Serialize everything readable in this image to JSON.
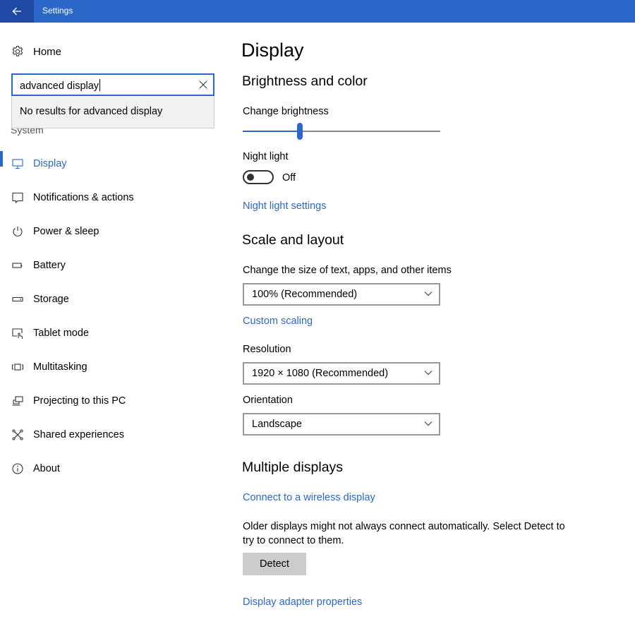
{
  "window": {
    "title": "Settings",
    "back_icon": "arrow-left-icon",
    "accent_color": "#2b67c8",
    "back_button_color": "#1f49a4"
  },
  "sidebar": {
    "home": {
      "label": "Home",
      "icon": "gear-icon"
    },
    "search": {
      "value": "advanced display",
      "clear_icon": "close-icon"
    },
    "search_results": {
      "message": "No results for advanced display"
    },
    "section_label": "System",
    "items": [
      {
        "label": "Display",
        "icon": "monitor-icon",
        "active": true
      },
      {
        "label": "Notifications & actions",
        "icon": "speech-bubble-icon",
        "active": false
      },
      {
        "label": "Power & sleep",
        "icon": "power-icon",
        "active": false
      },
      {
        "label": "Battery",
        "icon": "battery-icon",
        "active": false
      },
      {
        "label": "Storage",
        "icon": "storage-drive-icon",
        "active": false
      },
      {
        "label": "Tablet mode",
        "icon": "tablet-touch-icon",
        "active": false
      },
      {
        "label": "Multitasking",
        "icon": "multitasking-icon",
        "active": false
      },
      {
        "label": "Projecting to this PC",
        "icon": "projecting-icon",
        "active": false
      },
      {
        "label": "Shared experiences",
        "icon": "shared-experiences-icon",
        "active": false
      },
      {
        "label": "About",
        "icon": "info-icon",
        "active": false
      }
    ]
  },
  "main": {
    "page_title": "Display",
    "brightness_section": {
      "heading": "Brightness and color",
      "brightness_label": "Change brightness",
      "brightness_value_fraction": 0.29,
      "night_light_label": "Night light",
      "night_light_state": "Off",
      "night_light_on": false,
      "night_light_settings_link": "Night light settings"
    },
    "scale_section": {
      "heading": "Scale and layout",
      "scale_label": "Change the size of text, apps, and other items",
      "scale_value": "100% (Recommended)",
      "custom_scaling_link": "Custom scaling",
      "resolution_label": "Resolution",
      "resolution_value": "1920 × 1080 (Recommended)",
      "orientation_label": "Orientation",
      "orientation_value": "Landscape"
    },
    "multiple_displays_section": {
      "heading": "Multiple displays",
      "wireless_link": "Connect to a wireless display",
      "description": "Older displays might not always connect automatically. Select Detect to try to connect to them.",
      "detect_button": "Detect",
      "adapter_link": "Display adapter properties"
    }
  }
}
